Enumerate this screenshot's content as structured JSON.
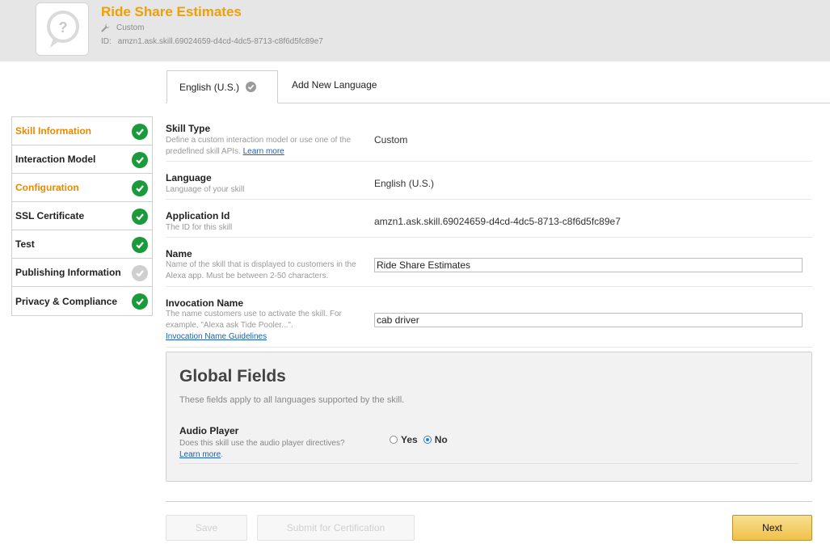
{
  "header": {
    "title": "Skill Information",
    "skill_name": "Ride Share Estimates",
    "skill_type": "Custom",
    "id_label": "ID:",
    "skill_id": "amzn1.ask.skill.69024659-d4cd-4dc5-8713-c8f6d5fc89e7",
    "icon": "question-mark-speech-bubble-icon",
    "brand_color": "#f0a000"
  },
  "tabs": {
    "active_label": "English (U.S.)",
    "add_label": "Add New Language"
  },
  "sidebar": {
    "items": [
      {
        "label": "Skill Information",
        "active": true,
        "status": "complete"
      },
      {
        "label": "Interaction Model",
        "active": false,
        "status": "complete"
      },
      {
        "label": "Configuration",
        "active": true,
        "status": "complete"
      },
      {
        "label": "SSL Certificate",
        "active": false,
        "status": "complete"
      },
      {
        "label": "Test",
        "active": false,
        "status": "complete"
      },
      {
        "label": "Publishing Information",
        "active": false,
        "status": "pending"
      },
      {
        "label": "Privacy & Compliance",
        "active": false,
        "status": "complete"
      }
    ]
  },
  "form": {
    "skill_type": {
      "label": "Skill Type",
      "desc": "Define a custom interaction model or use one of the predefined skill APIs.",
      "link": "Learn more",
      "value": "Custom"
    },
    "language": {
      "label": "Language",
      "desc": "Language of your skill",
      "value": "English (U.S.)"
    },
    "application_id": {
      "label": "Application Id",
      "desc": "The ID for this skill",
      "value": "amzn1.ask.skill.69024659-d4cd-4dc5-8713-c8f6d5fc89e7"
    },
    "name": {
      "label": "Name",
      "desc": "Name of the skill that is displayed to customers in the Alexa app. Must be between 2-50 characters.",
      "value": "Ride Share Estimates"
    },
    "invocation": {
      "label": "Invocation Name",
      "desc": "The name customers use to activate the skill. For example, \"Alexa ask Tide Pooler...\".",
      "link": "Invocation Name Guidelines",
      "value": "cab driver"
    }
  },
  "global_fields": {
    "title": "Global Fields",
    "desc": "These fields apply to all languages supported by the skill.",
    "audio_player": {
      "label": "Audio Player",
      "desc": "Does this skill use the audio player directives?",
      "link": "Learn more",
      "yes_label": "Yes",
      "no_label": "No",
      "selected": "No"
    }
  },
  "buttons": {
    "save": "Save",
    "submit": "Submit for Certification",
    "next": "Next"
  },
  "colors": {
    "accent_orange": "#e68a00",
    "check_green": "#1a9a3a",
    "check_pending": "#cfcfcf",
    "link_blue": "#1a5fb4",
    "next_button": "#f0c14b"
  }
}
